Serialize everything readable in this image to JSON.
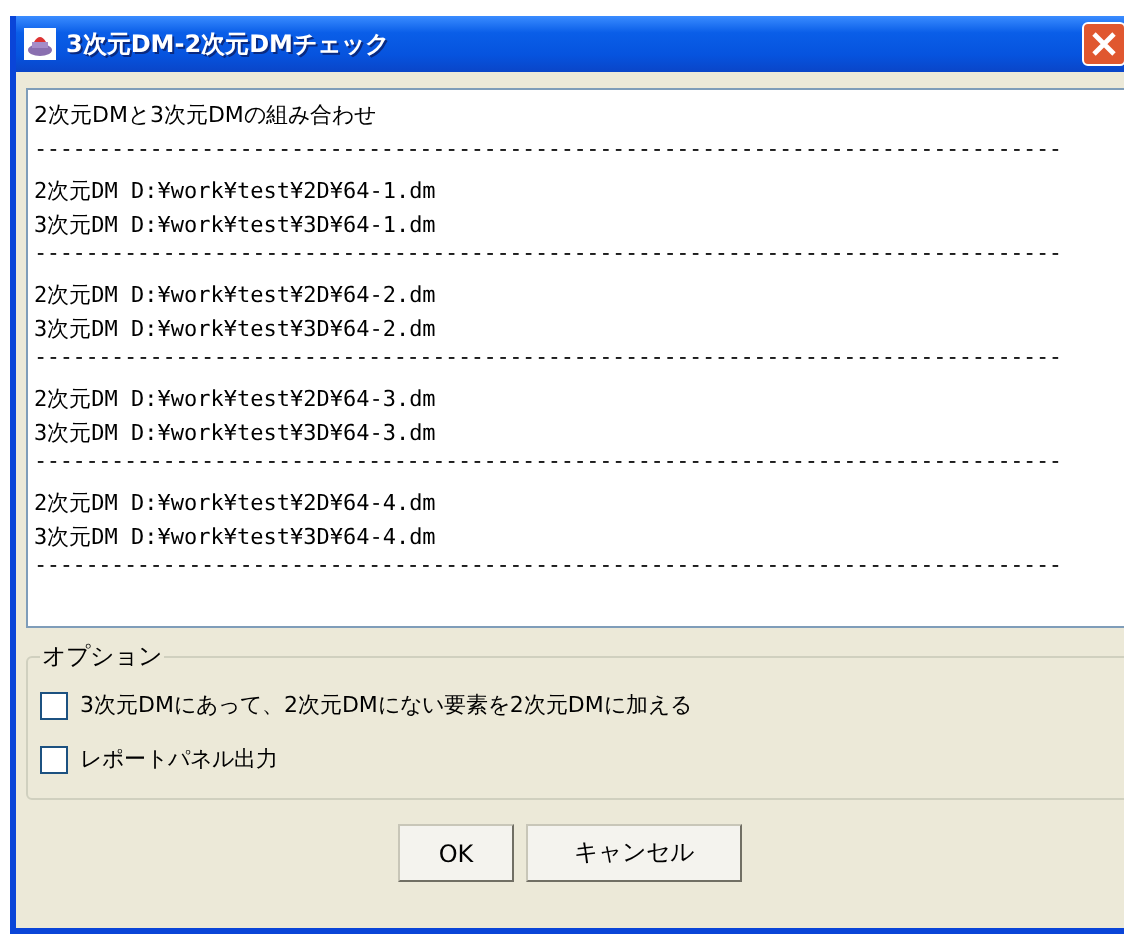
{
  "window": {
    "title": "3次元DM-2次元DMチェック"
  },
  "output": {
    "lines": [
      {
        "kind": "text",
        "text": "2次元DMと3次元DMの組み合わせ"
      },
      {
        "kind": "separator",
        "text": "--------------------------------------------------------------------------------"
      },
      {
        "kind": "text",
        "text": "2次元DM D:¥work¥test¥2D¥64-1.dm"
      },
      {
        "kind": "text",
        "text": "3次元DM D:¥work¥test¥3D¥64-1.dm"
      },
      {
        "kind": "separator",
        "text": "--------------------------------------------------------------------------------"
      },
      {
        "kind": "text",
        "text": "2次元DM D:¥work¥test¥2D¥64-2.dm"
      },
      {
        "kind": "text",
        "text": "3次元DM D:¥work¥test¥3D¥64-2.dm"
      },
      {
        "kind": "separator",
        "text": "--------------------------------------------------------------------------------"
      },
      {
        "kind": "text",
        "text": "2次元DM D:¥work¥test¥2D¥64-3.dm"
      },
      {
        "kind": "text",
        "text": "3次元DM D:¥work¥test¥3D¥64-3.dm"
      },
      {
        "kind": "separator",
        "text": "--------------------------------------------------------------------------------"
      },
      {
        "kind": "text",
        "text": "2次元DM D:¥work¥test¥2D¥64-4.dm"
      },
      {
        "kind": "text",
        "text": "3次元DM D:¥work¥test¥3D¥64-4.dm"
      },
      {
        "kind": "separator",
        "text": "--------------------------------------------------------------------------------"
      }
    ]
  },
  "options": {
    "title": "オプション",
    "checkboxes": [
      {
        "label": "3次元DMにあって、2次元DMにない要素を2次元DMに加える",
        "checked": false
      },
      {
        "label": "レポートパネル出力",
        "checked": false
      }
    ]
  },
  "buttons": [
    "OK",
    "キャンセル"
  ]
}
